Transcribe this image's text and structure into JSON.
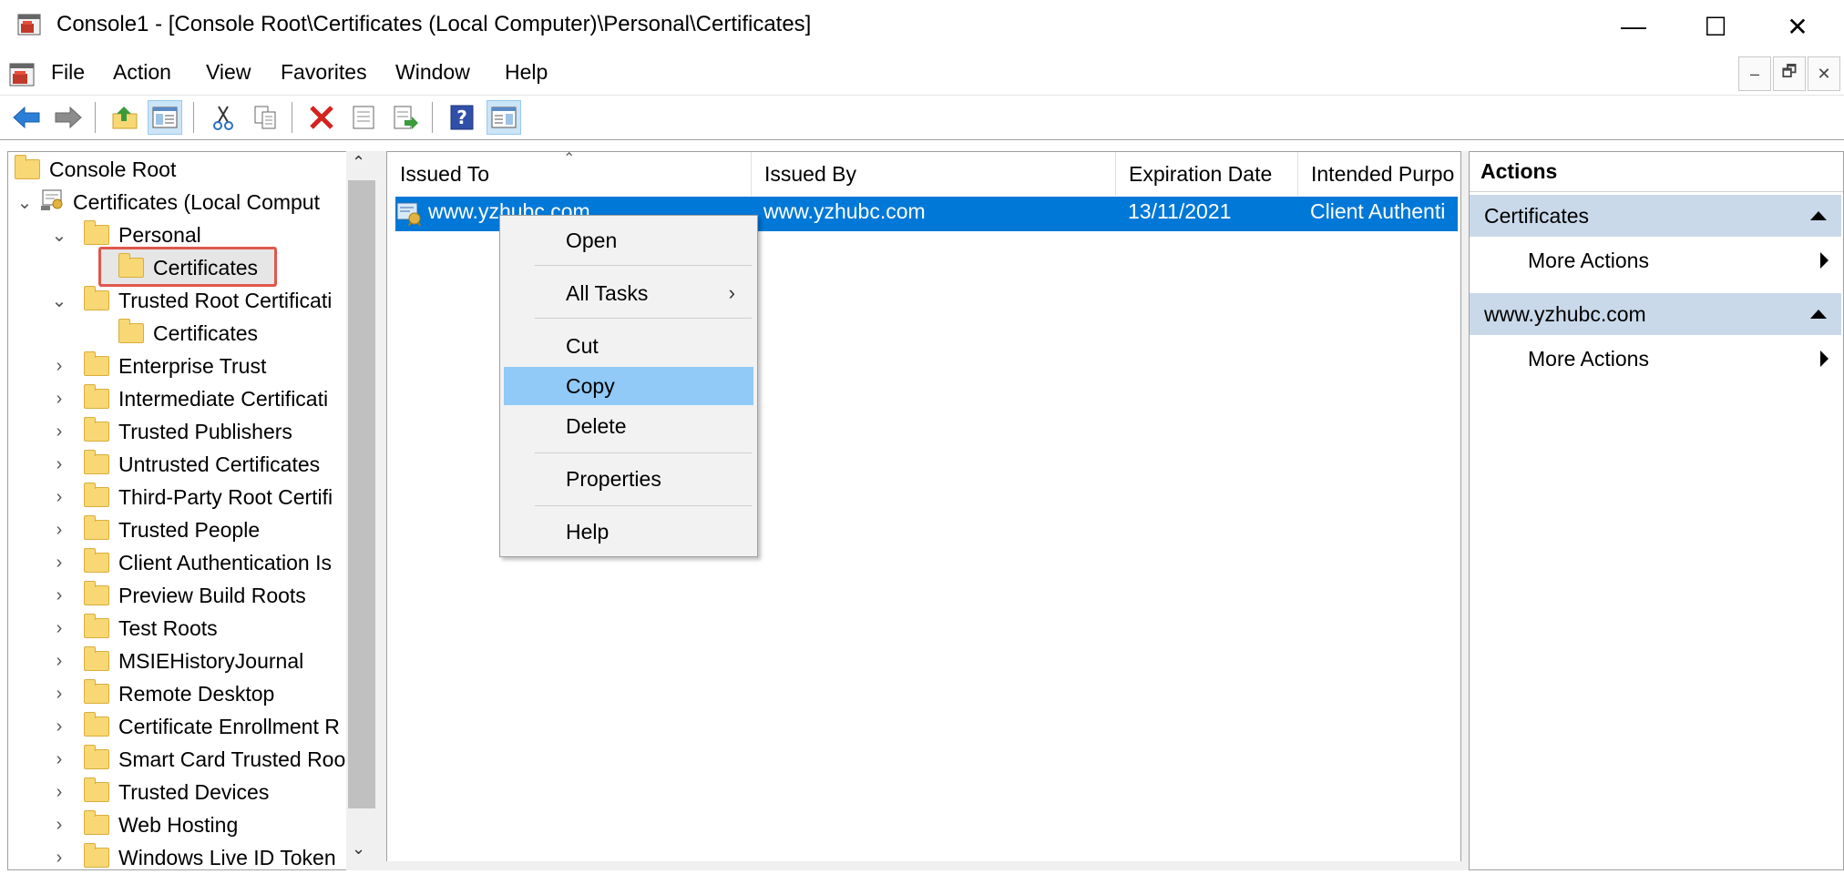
{
  "window": {
    "title": "Console1 - [Console Root\\Certificates (Local Computer)\\Personal\\Certificates]",
    "minimize": "—",
    "maximize": "☐",
    "close": "✕"
  },
  "menu": {
    "items": [
      "File",
      "Action",
      "View",
      "Favorites",
      "Window",
      "Help"
    ],
    "mdi": [
      "–",
      "🗗",
      "✕"
    ]
  },
  "tree": {
    "items": [
      {
        "label": "Console Root"
      },
      {
        "label": "Certificates (Local Comput"
      },
      {
        "label": "Personal"
      },
      {
        "label": "Certificates"
      },
      {
        "label": "Trusted Root Certificati"
      },
      {
        "label": "Certificates"
      },
      {
        "label": "Enterprise Trust"
      },
      {
        "label": "Intermediate Certificati"
      },
      {
        "label": "Trusted Publishers"
      },
      {
        "label": "Untrusted Certificates"
      },
      {
        "label": "Third-Party Root Certifi"
      },
      {
        "label": "Trusted People"
      },
      {
        "label": "Client Authentication Is"
      },
      {
        "label": "Preview Build Roots"
      },
      {
        "label": "Test Roots"
      },
      {
        "label": "MSIEHistoryJournal"
      },
      {
        "label": "Remote Desktop"
      },
      {
        "label": "Certificate Enrollment R"
      },
      {
        "label": "Smart Card Trusted Roo"
      },
      {
        "label": "Trusted Devices"
      },
      {
        "label": "Web Hosting"
      },
      {
        "label": "Windows Live ID Token"
      }
    ]
  },
  "list": {
    "columns": [
      "Issued To",
      "Issued By",
      "Expiration Date",
      "Intended Purpo"
    ],
    "rows": [
      {
        "issued_to": "www.yzhubc.com",
        "issued_by": "www.yzhubc.com",
        "expiration": "13/11/2021",
        "purpose": "Client Authenti"
      }
    ]
  },
  "context_menu": {
    "items": [
      "Open",
      "All Tasks",
      "Cut",
      "Copy",
      "Delete",
      "Properties",
      "Help"
    ],
    "submenu_arrow": "›"
  },
  "actions": {
    "header": "Actions",
    "groups": [
      {
        "title": "Certificates",
        "item": "More Actions"
      },
      {
        "title": "www.yzhubc.com",
        "item": "More Actions"
      }
    ]
  },
  "colors": {
    "selection": "#0078d7",
    "menu_hover": "#91c9f7",
    "highlight_border": "#e0574c",
    "action_group": "#c9d9ea"
  }
}
